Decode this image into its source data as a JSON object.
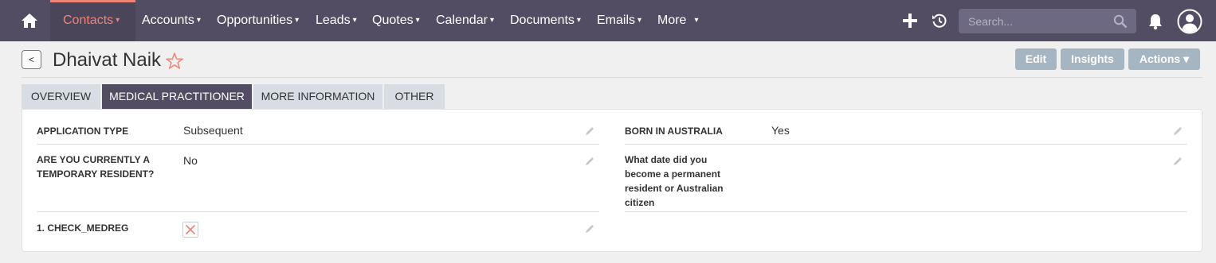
{
  "nav": {
    "items": [
      {
        "label": "Contacts"
      },
      {
        "label": "Accounts"
      },
      {
        "label": "Opportunities"
      },
      {
        "label": "Leads"
      },
      {
        "label": "Quotes"
      },
      {
        "label": "Calendar"
      },
      {
        "label": "Documents"
      },
      {
        "label": "Emails"
      },
      {
        "label": "More"
      }
    ],
    "caret": "▾",
    "search_placeholder": "Search..."
  },
  "header": {
    "back_label": "<",
    "title": "Dhaivat Naik",
    "buttons": {
      "edit": "Edit",
      "insights": "Insights",
      "actions": "Actions ▾"
    }
  },
  "tabs": [
    {
      "label": "OVERVIEW"
    },
    {
      "label": "MEDICAL PRACTITIONER",
      "active": true
    },
    {
      "label": "MORE INFORMATION"
    },
    {
      "label": "OTHER"
    }
  ],
  "fields": {
    "application_type": {
      "label": "APPLICATION TYPE",
      "value": "Subsequent"
    },
    "born_in_australia": {
      "label": "BORN IN AUSTRALIA",
      "value": "Yes"
    },
    "temporary_resident": {
      "label_lines": [
        "ARE YOU CURRENTLY A",
        "TEMPORARY RESIDENT?"
      ],
      "value": "No"
    },
    "permanent_date": {
      "label_lines": [
        "What date did you",
        "become a permanent",
        "resident or Australian",
        "citizen"
      ],
      "value": ""
    },
    "check_medreg": {
      "label": "1. CHECK_MEDREG",
      "value": "unchecked"
    }
  },
  "colors": {
    "nav_bg": "#534d64",
    "accent": "#f08377",
    "button_bg": "#a6b5c2",
    "tab_bg": "#d7dde3"
  }
}
